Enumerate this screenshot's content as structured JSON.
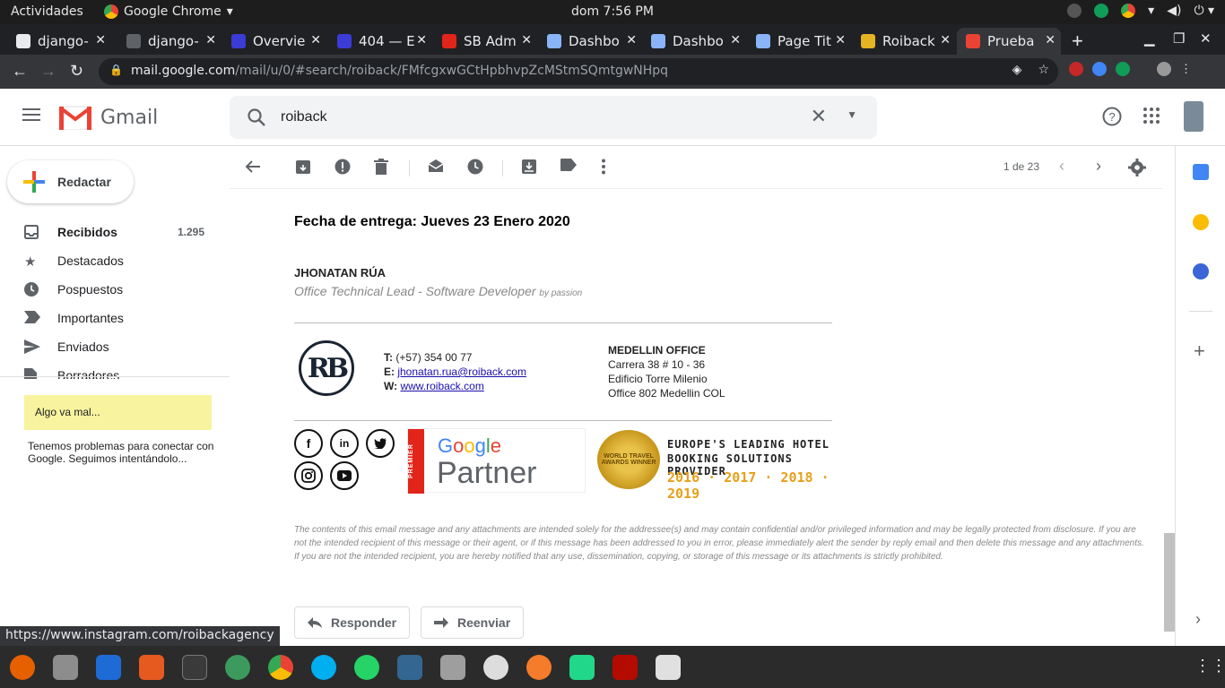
{
  "system": {
    "activities": "Actividades",
    "app_name": "Google Chrome",
    "clock": "dom  7:56 PM"
  },
  "tabs": [
    {
      "label": "django-",
      "color": "#e8eaed"
    },
    {
      "label": "django-",
      "color": "#5f6368"
    },
    {
      "label": "Overvie",
      "color": "#3b3bd6"
    },
    {
      "label": "404 — E",
      "color": "#3b3bd6"
    },
    {
      "label": "SB Adm",
      "color": "#e1251b"
    },
    {
      "label": "Dashbo",
      "color": "#8ab4f8"
    },
    {
      "label": "Dashbo",
      "color": "#8ab4f8"
    },
    {
      "label": "Page Tit",
      "color": "#8ab4f8"
    },
    {
      "label": "Roiback",
      "color": "#e6b422"
    },
    {
      "label": "Prueba",
      "color": "#ea4335"
    }
  ],
  "url": {
    "host": "mail.google.com",
    "path": "/mail/u/0/#search/roiback/FMfcgxwGCtHpbhvpZcMStmSQmtgwNHpq"
  },
  "gmail": {
    "brand": "Gmail",
    "search_value": "roiback",
    "compose": "Redactar",
    "nav": [
      {
        "label": "Recibidos",
        "count": "1.295",
        "icon": "inbox-icon"
      },
      {
        "label": "Destacados",
        "count": "",
        "icon": "star-icon"
      },
      {
        "label": "Pospuestos",
        "count": "",
        "icon": "clock-icon"
      },
      {
        "label": "Importantes",
        "count": "",
        "icon": "important-icon"
      },
      {
        "label": "Enviados",
        "count": "",
        "icon": "send-icon"
      },
      {
        "label": "Borradores",
        "count": "",
        "icon": "draft-icon"
      }
    ],
    "warning_title": "Algo va mal...",
    "warning_message": "Tenemos problemas para conectar con Google. Seguimos intentándolo...",
    "pager": "1 de 23"
  },
  "message": {
    "delivery": "Fecha de entrega: Jueves 23 Enero 2020",
    "sig_name": "JHONATAN RÚA",
    "sig_role": "Office Technical Lead - Software Developer",
    "sig_role_tag": "by passion",
    "logo_text": "RB",
    "phone_label": "T:",
    "phone": "(+57) 354 00 77",
    "email_label": "E:",
    "email": "jhonatan.rua@roiback.com",
    "web_label": "W:",
    "web": "www.roiback.com",
    "office_title": "MEDELLIN OFFICE",
    "office_line1": "Carrera 38 # 10 - 36",
    "office_line2": "Edificio Torre Milenio",
    "office_line3": "Office 802 Medellin COL",
    "partner_badge": "PREMIER",
    "partner_google": "Google",
    "partner_word": "Partner",
    "award_line1": "EUROPE'S LEADING HOTEL",
    "award_line2": "BOOKING SOLUTIONS PROVIDER",
    "award_years": "2016 · 2017 · 2018 · 2019",
    "award_medal": "WORLD TRAVEL AWARDS WINNER",
    "disclaimer": "The contents of this email message and any attachments are intended solely for the addressee(s) and may contain confidential and/or privileged information and may be legally protected from disclosure. If you are not the intended recipient of this message or their agent, or if this message has been addressed to you in error, please immediately alert the sender by reply email and then delete this message and any attachments. If you are not the intended recipient, you are hereby notified that any use, dissemination, copying, or storage of this message or its attachments is strictly prohibited.",
    "reply": "Responder",
    "forward": "Reenviar"
  },
  "status_link": "https://www.instagram.com/roibackagency"
}
